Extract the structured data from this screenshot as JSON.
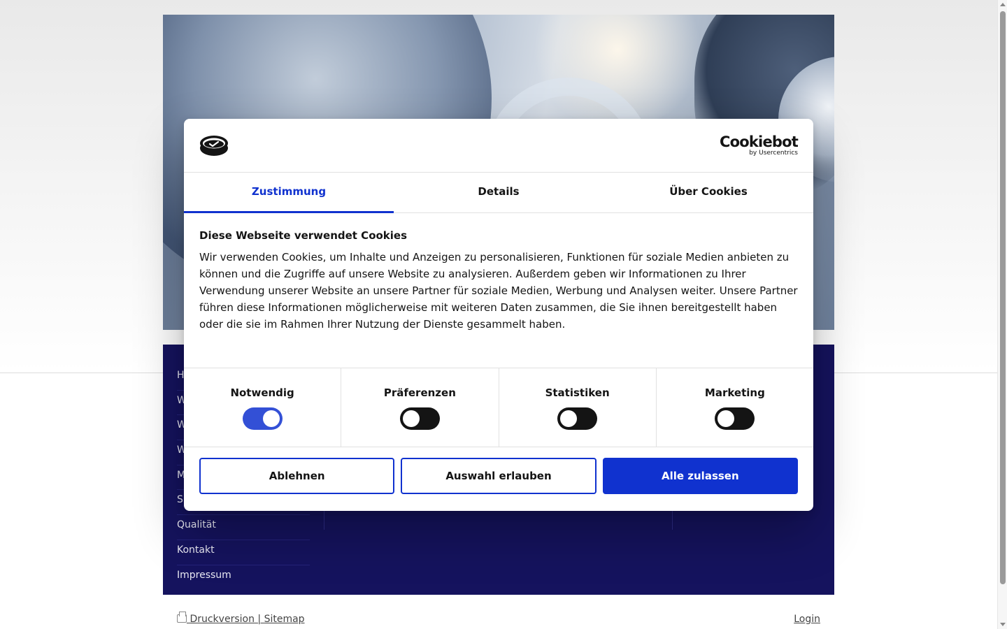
{
  "footer_nav": {
    "items": [
      "H",
      "W",
      "W",
      "W",
      "M",
      "S",
      "Qualität",
      "Kontakt",
      "Impressum"
    ]
  },
  "bottom_bar": {
    "print_label": " Druckversion",
    "separator": " | ",
    "sitemap_label": "Sitemap",
    "login_label": "Login"
  },
  "cookie_dialog": {
    "brand": {
      "name": "Cookiebot",
      "sub": "by Usercentrics",
      "logo_icon": "cookie-logo-icon"
    },
    "tabs": [
      {
        "label": "Zustimmung",
        "active": true
      },
      {
        "label": "Details",
        "active": false
      },
      {
        "label": "Über Cookies",
        "active": false
      }
    ],
    "title": "Diese Webseite verwendet Cookies",
    "text": "Wir verwenden Cookies, um Inhalte und Anzeigen zu personalisieren, Funktionen für soziale Medien anbieten zu können und die Zugriffe auf unsere Website zu analysieren. Außerdem geben wir Informationen zu Ihrer Verwendung unserer Website an unsere Partner für soziale Medien, Werbung und Analysen weiter. Unsere Partner führen diese Informationen möglicherweise mit weiteren Daten zusammen, die Sie ihnen bereitgestellt haben oder die sie im Rahmen Ihrer Nutzung der Dienste gesammelt haben.",
    "categories": [
      {
        "label": "Notwendig",
        "enabled": true
      },
      {
        "label": "Präferenzen",
        "enabled": false
      },
      {
        "label": "Statistiken",
        "enabled": false
      },
      {
        "label": "Marketing",
        "enabled": false
      }
    ],
    "buttons": {
      "decline": "Ablehnen",
      "allow_selection": "Auswahl erlauben",
      "allow_all": "Alle zulassen"
    }
  },
  "colors": {
    "accent": "#1032cf",
    "footer_navy": "#15135e",
    "text": "#141414"
  }
}
